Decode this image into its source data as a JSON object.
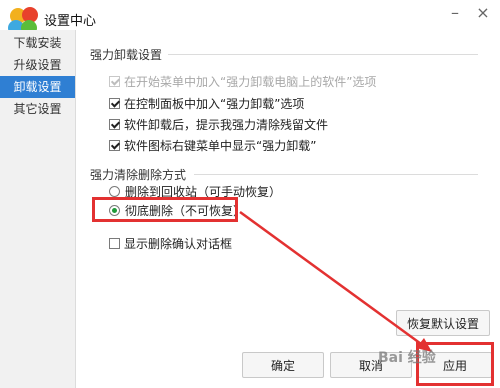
{
  "window": {
    "title": "设置中心",
    "minimize": "–",
    "close": "×"
  },
  "sidebar": {
    "items": [
      {
        "label": "下载安装",
        "active": false
      },
      {
        "label": "升级设置",
        "active": false
      },
      {
        "label": "卸载设置",
        "active": true
      },
      {
        "label": "其它设置",
        "active": false
      }
    ]
  },
  "main": {
    "uninstall_section": {
      "title": "强力卸载设置",
      "options": [
        {
          "label": "在开始菜单中加入“强力卸载电脑上的软件”选项",
          "checked": true,
          "disabled": true
        },
        {
          "label": "在控制面板中加入“强力卸载”选项",
          "checked": true,
          "disabled": false
        },
        {
          "label": "软件卸载后，提示我强力清除残留文件",
          "checked": true,
          "disabled": false
        },
        {
          "label": "软件图标右键菜单中显示“强力卸载”",
          "checked": true,
          "disabled": false
        }
      ]
    },
    "clean_section": {
      "title": "强力清除删除方式",
      "radios": [
        {
          "label": "删除到回收站（可手动恢复）",
          "selected": false
        },
        {
          "label": "彻底删除（不可恢复）",
          "selected": true
        }
      ],
      "confirm_dialog": {
        "label": "显示删除确认对话框",
        "checked": false
      }
    },
    "buttons": {
      "restore": "恢复默认设置",
      "ok": "确定",
      "cancel": "取消",
      "apply": "应用"
    }
  },
  "watermark": {
    "text": "Bai 经验"
  },
  "colors": {
    "accent": "#2f7fd3",
    "annotation": "#e33131",
    "radio_dot": "#1f9a3a"
  }
}
